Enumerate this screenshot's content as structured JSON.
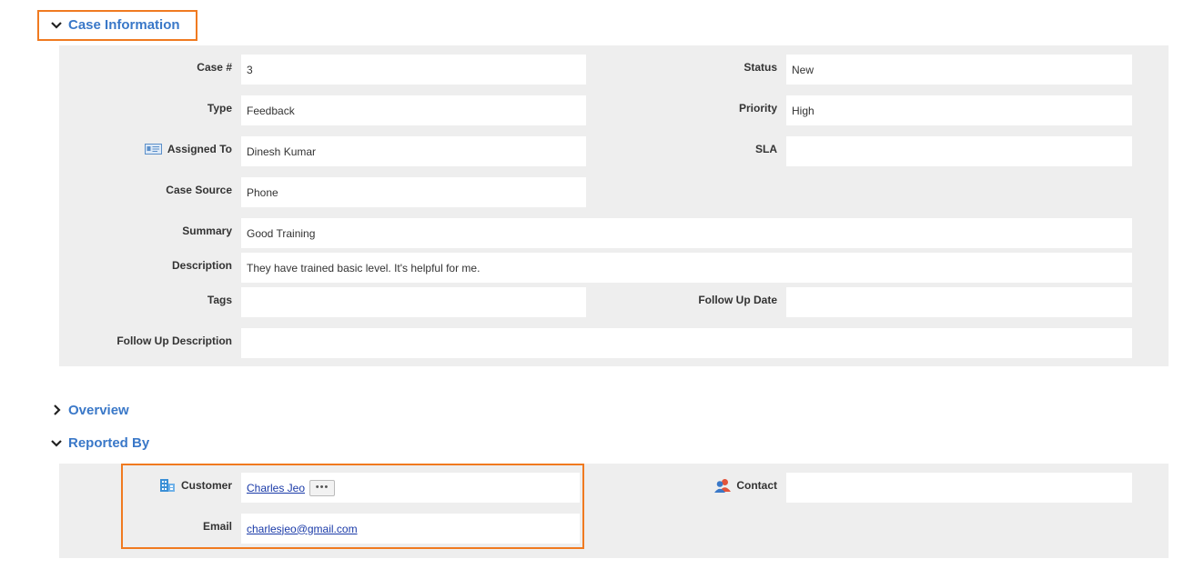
{
  "sections": {
    "case_information": "Case Information",
    "overview": "Overview",
    "reported_by": "Reported By"
  },
  "case": {
    "case_no_label": "Case #",
    "case_no": "3",
    "status_label": "Status",
    "status": "New",
    "type_label": "Type",
    "type": "Feedback",
    "priority_label": "Priority",
    "priority": "High",
    "assigned_to_label": "Assigned To",
    "assigned_to": "Dinesh Kumar",
    "sla_label": "SLA",
    "sla": "",
    "case_source_label": "Case Source",
    "case_source": "Phone",
    "summary_label": "Summary",
    "summary": "Good Training",
    "description_label": "Description",
    "description": "They have trained basic level. It's helpful for me.",
    "tags_label": "Tags",
    "tags": "",
    "follow_up_date_label": "Follow Up Date",
    "follow_up_date": "",
    "follow_up_description_label": "Follow Up Description",
    "follow_up_description": ""
  },
  "reported_by": {
    "customer_label": "Customer",
    "customer": "Charles Jeo",
    "more_button": "•••",
    "contact_label": "Contact",
    "contact": "",
    "email_label": "Email",
    "email": "charlesjeo@gmail.com"
  },
  "icons": {
    "assigned_to": "id-card-icon",
    "customer": "building-icon",
    "contact": "contacts-icon",
    "expanded": "chevron-down-icon",
    "collapsed": "chevron-right-icon"
  },
  "colors": {
    "accent": "#3a78c8",
    "highlight": "#f07a20",
    "panel": "#eeeeee",
    "link": "#1a3aa8"
  }
}
